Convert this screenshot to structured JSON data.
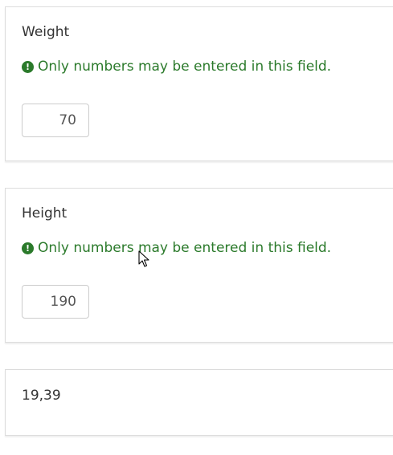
{
  "colors": {
    "tip_text": "#2b7a2b",
    "tip_icon_bg": "#2b7a2b",
    "border": "#dcdcdc"
  },
  "questions": [
    {
      "title": "Weight",
      "tip": "Only numbers may be entered in this field.",
      "tip_icon": "exclamation-circle-icon",
      "value": "70"
    },
    {
      "title": "Height",
      "tip": "Only numbers may be entered in this field.",
      "tip_icon": "exclamation-circle-icon",
      "value": "190"
    }
  ],
  "result": {
    "value": "19,39"
  },
  "tip_icon_glyph": "!"
}
